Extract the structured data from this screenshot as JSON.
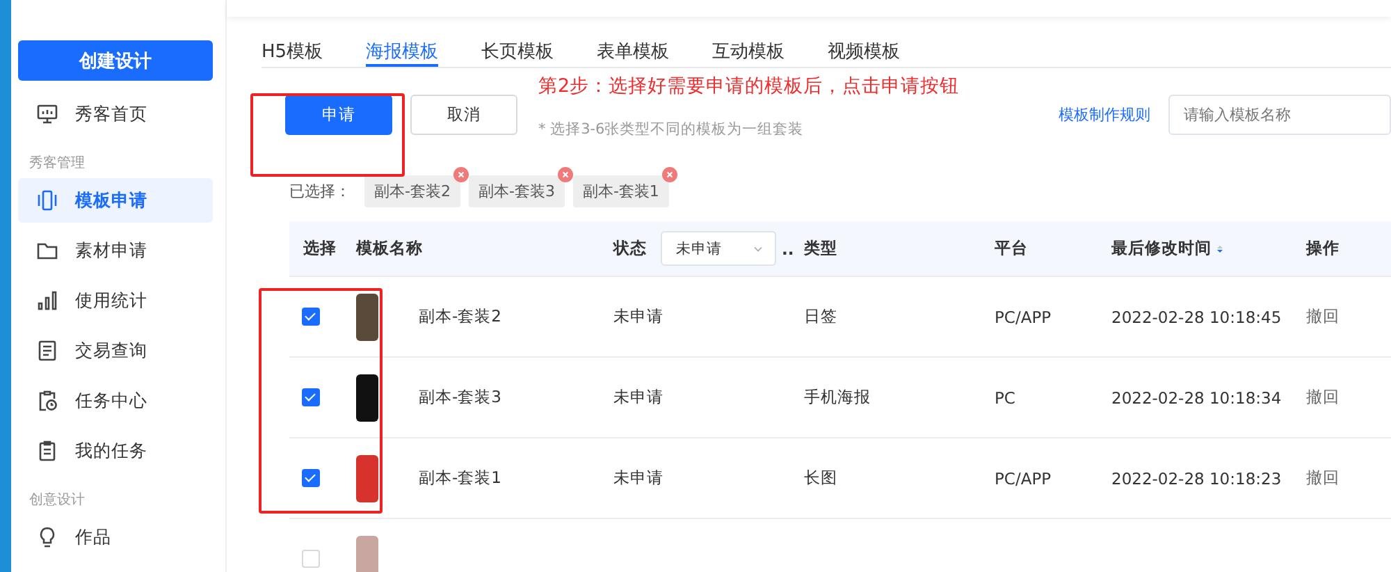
{
  "sidebar": {
    "create_button": "创建设计",
    "items": [
      {
        "kind": "item",
        "label": "秀客首页",
        "selected": false
      },
      {
        "kind": "group",
        "label": "秀客管理"
      },
      {
        "kind": "item",
        "label": "模板申请",
        "selected": true
      },
      {
        "kind": "item",
        "label": "素材申请",
        "selected": false
      },
      {
        "kind": "item",
        "label": "使用统计",
        "selected": false
      },
      {
        "kind": "item",
        "label": "交易查询",
        "selected": false
      },
      {
        "kind": "item",
        "label": "任务中心",
        "selected": false
      },
      {
        "kind": "item",
        "label": "我的任务",
        "selected": false
      },
      {
        "kind": "group",
        "label": "创意设计"
      },
      {
        "kind": "item",
        "label": "作品",
        "selected": false
      }
    ]
  },
  "tabs": [
    {
      "label": "H5模板",
      "selected": false
    },
    {
      "label": "海报模板",
      "selected": true
    },
    {
      "label": "长页模板",
      "selected": false
    },
    {
      "label": "表单模板",
      "selected": false
    },
    {
      "label": "互动模板",
      "selected": false
    },
    {
      "label": "视频模板",
      "selected": false
    }
  ],
  "toolbar": {
    "apply_button": "申请",
    "cancel_button": "取消",
    "hint": "* 选择3-6张类型不同的模板为一组套装",
    "rules_link": "模板制作规则",
    "search": {
      "placeholder": "请输入模板名称"
    }
  },
  "annotation": "第2步：选择好需要申请的模板后，点击申请按钮",
  "selected_label": "已选择：",
  "selected_tags": [
    "副本-套装2",
    "副本-套装3",
    "副本-套装1"
  ],
  "table": {
    "columns": [
      "选择",
      "模板名称",
      "状态",
      "类型",
      "平台",
      "最后修改时间",
      "操作"
    ],
    "status_filter": "未申请",
    "status_more": "..",
    "rows": [
      {
        "checked": true,
        "name": "副本-套装2",
        "status": "未申请",
        "type": "日签",
        "platform": "PC/APP",
        "time": "2022-02-28 10:18:45",
        "action": "撤回"
      },
      {
        "checked": true,
        "name": "副本-套装3",
        "status": "未申请",
        "type": "手机海报",
        "platform": "PC",
        "time": "2022-02-28 10:18:34",
        "action": "撤回"
      },
      {
        "checked": true,
        "name": "副本-套装1",
        "status": "未申请",
        "type": "长图",
        "platform": "PC/APP",
        "time": "2022-02-28 10:18:23",
        "action": "撤回"
      },
      {
        "checked": false
      }
    ]
  }
}
